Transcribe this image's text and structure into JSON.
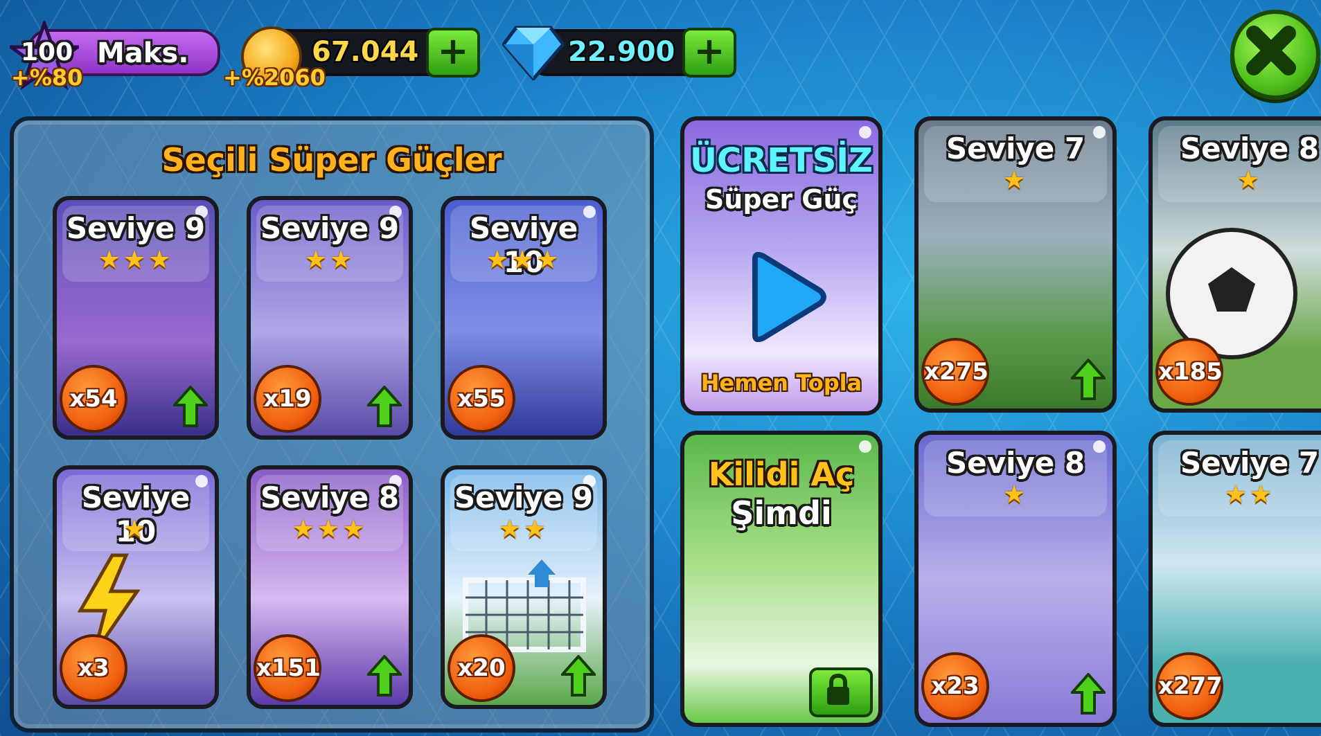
{
  "topbar": {
    "xp": {
      "level": "100",
      "label": "Maks.",
      "bonus": "+%80"
    },
    "coins": {
      "value": "67.044",
      "bonus": "+%2060",
      "add_label": "+"
    },
    "gems": {
      "value": "22.900",
      "add_label": "+"
    }
  },
  "selected_panel": {
    "title": "Seçili Süper Güçler",
    "cards": [
      {
        "level": "Seviye 9",
        "stars": "★★★",
        "count": "x54",
        "theme": "#6a5ad0"
      },
      {
        "level": "Seviye 9",
        "stars": "★★",
        "count": "x19",
        "theme": "#7b6ed8"
      },
      {
        "level": "Seviye 10",
        "stars": "★★★",
        "count": "x55",
        "theme": "#5a6fd6"
      },
      {
        "level": "Seviye 10",
        "stars": "★",
        "count": "x3",
        "theme": "#8a7ae0"
      },
      {
        "level": "Seviye 8",
        "stars": "★★★",
        "count": "x151",
        "theme": "#9a6ad0"
      },
      {
        "level": "Seviye 9",
        "stars": "★★",
        "count": "x20",
        "theme": "#7ab0e0"
      }
    ]
  },
  "free_card": {
    "title": "ÜCRETSİZ",
    "subtitle": "Süper Güç",
    "action": "Hemen Topla"
  },
  "unlock_card": {
    "title": "Kilidi Aç",
    "subtitle": "Şimdi"
  },
  "right_cards": [
    {
      "level": "Seviye 7",
      "stars": "★",
      "count": "x275"
    },
    {
      "level": "Seviye 8",
      "stars": "★",
      "count": "x185"
    },
    {
      "level": "Seviye 8",
      "stars": "★",
      "count": "x23"
    },
    {
      "level": "Seviye 7",
      "stars": "★★",
      "count": "x277"
    }
  ],
  "colors": {
    "accent_orange": "#ffb21c",
    "gem_cyan": "#6ef0ff",
    "button_green": "#4fc21c"
  }
}
